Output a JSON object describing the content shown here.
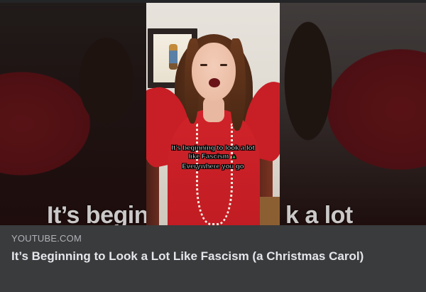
{
  "link_preview": {
    "domain": "YOUTUBE.COM",
    "title": "It’s Beginning to Look a Lot Like Fascism (a Christmas Carol)"
  },
  "thumbnail": {
    "background_text_left": "It’s begin",
    "background_text_right": "k a lot",
    "caption_line_1": "It's beginning to look a lot",
    "caption_line_2": "like Fascism",
    "caption_line_3": "Everywhere you go",
    "caption_icon": "christmas-tree-icon"
  },
  "colors": {
    "card_background": "#3a3b3c",
    "domain_text": "#b0b3b8",
    "title_text": "#e4e6eb",
    "dress_red": "#c81e25"
  }
}
